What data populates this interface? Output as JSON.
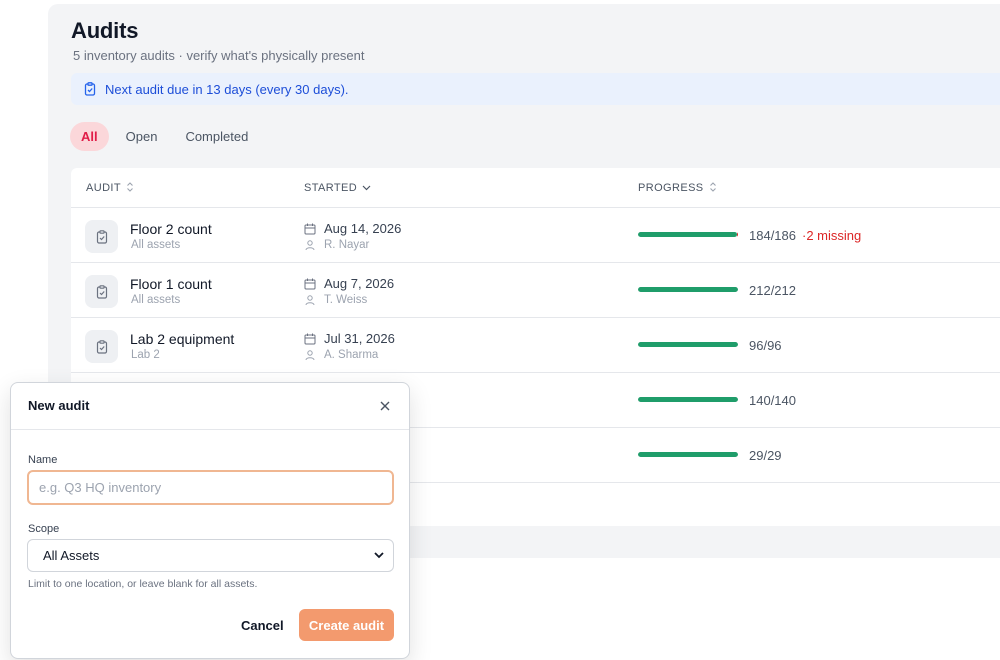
{
  "header": {
    "title": "Audits",
    "subtitle": "5 inventory audits · verify what's physically present"
  },
  "notice": {
    "text": "Next audit due in 13 days (every 30 days).",
    "icon": "clipboard-icon"
  },
  "tabs": [
    {
      "label": "All",
      "active": true
    },
    {
      "label": "Open",
      "active": false
    },
    {
      "label": "Completed",
      "active": false
    }
  ],
  "table": {
    "columns": {
      "audit": "AUDIT",
      "started": "STARTED",
      "progress": "PROGRESS"
    },
    "rows": [
      {
        "name": "Floor 2 count",
        "scope": "All assets",
        "date": "Aug 14, 2026",
        "user": "R. Nayar",
        "counted": 184,
        "total": 186,
        "progress_text": "184/186",
        "missing_text": "·2 missing"
      },
      {
        "name": "Floor 1 count",
        "scope": "All assets",
        "date": "Aug 7, 2026",
        "user": "T. Weiss",
        "counted": 212,
        "total": 212,
        "progress_text": "212/212",
        "missing_text": ""
      },
      {
        "name": "Lab 2 equipment",
        "scope": "Lab 2",
        "date": "Jul 31, 2026",
        "user": "A. Sharma",
        "counted": 96,
        "total": 96,
        "progress_text": "96/96",
        "missing_text": ""
      },
      {
        "name": "",
        "scope": "",
        "date": "",
        "user": "",
        "counted": 140,
        "total": 140,
        "progress_text": "140/140",
        "missing_text": ""
      },
      {
        "name": "",
        "scope": "",
        "date": "",
        "user": "",
        "counted": 29,
        "total": 29,
        "progress_text": "29/29",
        "missing_text": ""
      }
    ]
  },
  "modal": {
    "title": "New audit",
    "name_label": "Name",
    "name_value": "",
    "name_placeholder": "e.g. Q3 HQ inventory",
    "scope_label": "Scope",
    "scope_selected": "All Assets",
    "scope_hint": "Limit to one location, or leave blank for all assets.",
    "cancel_label": "Cancel",
    "create_label": "Create audit"
  },
  "colors": {
    "accent": "#e11d48",
    "progress": "#1f9d6a",
    "missing": "#dc2626",
    "primary_button": "#f39a6e",
    "notice_bg": "#eaf1fd"
  }
}
